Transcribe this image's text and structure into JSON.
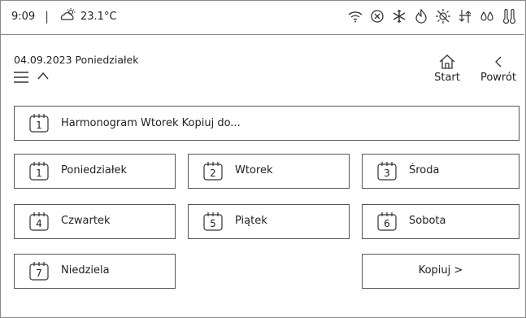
{
  "status": {
    "time": "9:09",
    "separator": "|",
    "temperature": "23.1°C"
  },
  "status_icons": [
    "wifi-icon",
    "circle-x-icon",
    "snowflake-icon",
    "flame-icon",
    "sun-off-icon",
    "heat-exchange-icon",
    "drops-icon",
    "thermo-icon"
  ],
  "header": {
    "date": "04.09.2023 Poniedziałek",
    "start_label": "Start",
    "back_label": "Powrót"
  },
  "schedule": {
    "calendar_number": "1",
    "title": "Harmonogram  Wtorek  Kopiuj do..."
  },
  "days": [
    {
      "number": "1",
      "label": "Poniedziałek"
    },
    {
      "number": "2",
      "label": "Wtorek"
    },
    {
      "number": "3",
      "label": "Środa"
    },
    {
      "number": "4",
      "label": "Czwartek"
    },
    {
      "number": "5",
      "label": "Piątek"
    },
    {
      "number": "6",
      "label": "Sobota"
    },
    {
      "number": "7",
      "label": "Niedziela"
    }
  ],
  "copy_button": {
    "label": "Kopiuj  >"
  }
}
